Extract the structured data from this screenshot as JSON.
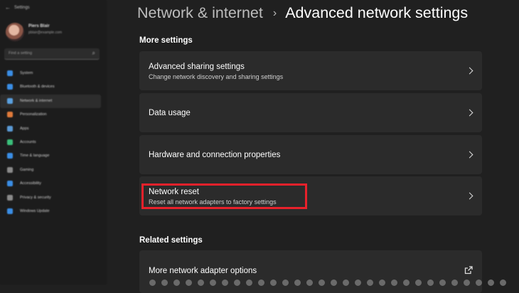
{
  "window": {
    "title": "Settings"
  },
  "user": {
    "name": "Piers Blair",
    "email": "pblair@example.com"
  },
  "search": {
    "placeholder": "Find a setting"
  },
  "sidebar": {
    "items": [
      {
        "label": "System",
        "color": "#3a8ee6"
      },
      {
        "label": "Bluetooth & devices",
        "color": "#3a8ee6"
      },
      {
        "label": "Network & internet",
        "color": "#5aa0e0"
      },
      {
        "label": "Personalization",
        "color": "#e07a3a"
      },
      {
        "label": "Apps",
        "color": "#5a9ad6"
      },
      {
        "label": "Accounts",
        "color": "#3ac07a"
      },
      {
        "label": "Time & language",
        "color": "#3a8ee6"
      },
      {
        "label": "Gaming",
        "color": "#8a8a8a"
      },
      {
        "label": "Accessibility",
        "color": "#3a8ee6"
      },
      {
        "label": "Privacy & security",
        "color": "#8a8a8a"
      },
      {
        "label": "Windows Update",
        "color": "#3a8ee6"
      }
    ]
  },
  "header": {
    "parent": "Network & internet",
    "separator": "›",
    "current": "Advanced network settings"
  },
  "sections": {
    "more": "More settings",
    "related": "Related settings"
  },
  "cards": {
    "sharing": {
      "title": "Advanced sharing settings",
      "subtitle": "Change network discovery and sharing settings"
    },
    "data_usage": {
      "title": "Data usage"
    },
    "hardware": {
      "title": "Hardware and connection properties"
    },
    "reset": {
      "title": "Network reset",
      "subtitle": "Reset all network adapters to factory settings"
    },
    "adapter": {
      "title": "More network adapter options"
    }
  },
  "colors": {
    "highlight": "#e8212b",
    "background": "#202020",
    "card": "#2b2b2b"
  }
}
